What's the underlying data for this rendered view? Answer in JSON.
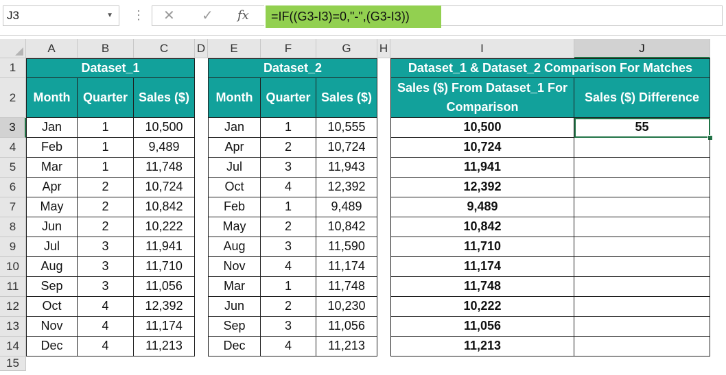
{
  "name_box": {
    "value": "J3"
  },
  "formula_bar": {
    "cancel": "✕",
    "enter": "✓",
    "fx": "fx",
    "formula": "=IF((G3-I3)=0,\"-\",(G3-I3))"
  },
  "columns": [
    "A",
    "B",
    "C",
    "D",
    "E",
    "F",
    "G",
    "H",
    "I",
    "J"
  ],
  "rows": [
    "1",
    "2",
    "3",
    "4",
    "5",
    "6",
    "7",
    "8",
    "9",
    "10",
    "11",
    "12",
    "13",
    "14",
    "15"
  ],
  "dataset1": {
    "title": "Dataset_1",
    "headers": [
      "Month",
      "Quarter",
      "Sales ($)"
    ],
    "rows": [
      [
        "Jan",
        "1",
        "10,500"
      ],
      [
        "Feb",
        "1",
        "9,489"
      ],
      [
        "Mar",
        "1",
        "11,748"
      ],
      [
        "Apr",
        "2",
        "10,724"
      ],
      [
        "May",
        "2",
        "10,842"
      ],
      [
        "Jun",
        "2",
        "10,222"
      ],
      [
        "Jul",
        "3",
        "11,941"
      ],
      [
        "Aug",
        "3",
        "11,710"
      ],
      [
        "Sep",
        "3",
        "11,056"
      ],
      [
        "Oct",
        "4",
        "12,392"
      ],
      [
        "Nov",
        "4",
        "11,174"
      ],
      [
        "Dec",
        "4",
        "11,213"
      ]
    ]
  },
  "dataset2": {
    "title": "Dataset_2",
    "headers": [
      "Month",
      "Quarter",
      "Sales ($)"
    ],
    "rows": [
      [
        "Jan",
        "1",
        "10,555"
      ],
      [
        "Apr",
        "2",
        "10,724"
      ],
      [
        "Jul",
        "3",
        "11,943"
      ],
      [
        "Oct",
        "4",
        "12,392"
      ],
      [
        "Feb",
        "1",
        "9,489"
      ],
      [
        "May",
        "2",
        "10,842"
      ],
      [
        "Aug",
        "3",
        "11,590"
      ],
      [
        "Nov",
        "4",
        "11,174"
      ],
      [
        "Mar",
        "1",
        "11,748"
      ],
      [
        "Jun",
        "2",
        "10,230"
      ],
      [
        "Sep",
        "3",
        "11,056"
      ],
      [
        "Dec",
        "4",
        "11,213"
      ]
    ]
  },
  "comparison": {
    "title": "Dataset_1 & Dataset_2 Comparison For Matches",
    "headers": [
      "Sales ($) From Dataset_1 For Comparison",
      "Sales ($) Difference"
    ],
    "from_dataset1": [
      "10,500",
      "10,724",
      "11,941",
      "12,392",
      "9,489",
      "10,842",
      "11,710",
      "11,174",
      "11,748",
      "10,222",
      "11,056",
      "11,213"
    ],
    "difference": [
      "55",
      "",
      "",
      "",
      "",
      "",
      "",
      "",
      "",
      "",
      "",
      ""
    ]
  }
}
